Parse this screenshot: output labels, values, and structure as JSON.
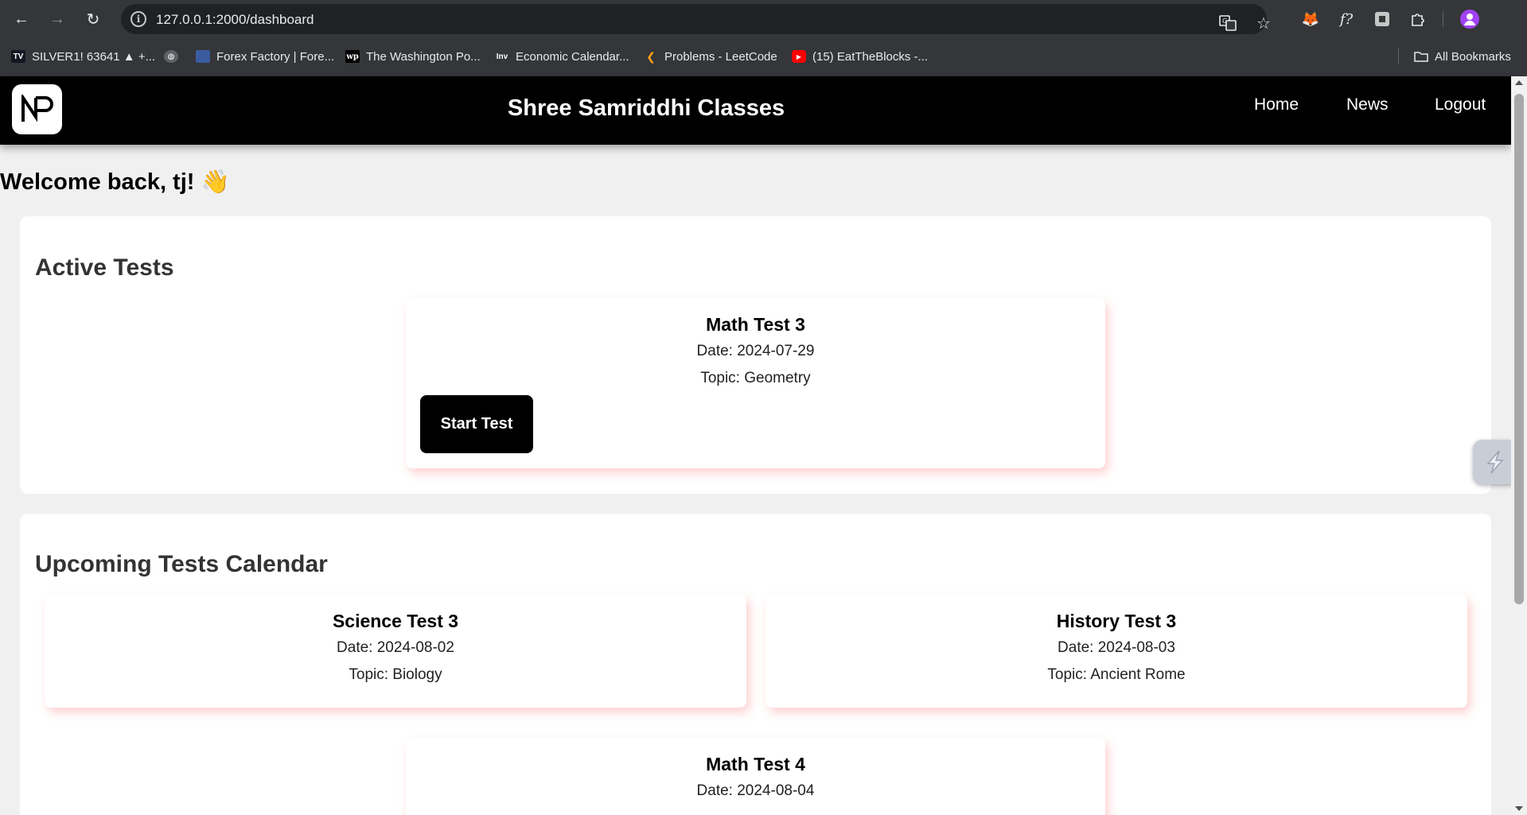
{
  "browser": {
    "url": "127.0.0.1:2000/dashboard",
    "bookmarks": [
      {
        "label": "SILVER1! 63641 ▲ +...",
        "icon": "tradingview-icon"
      },
      {
        "label": "",
        "icon": "globe-icon"
      },
      {
        "label": "Forex Factory | Fore...",
        "icon": "forex-factory-icon"
      },
      {
        "label": "The Washington Po...",
        "icon": "washington-post-icon"
      },
      {
        "label": "Economic Calendar...",
        "icon": "investing-icon"
      },
      {
        "label": "Problems - LeetCode",
        "icon": "leetcode-icon"
      },
      {
        "label": "(15) EatTheBlocks -...",
        "icon": "youtube-icon"
      }
    ],
    "all_bookmarks": "All Bookmarks"
  },
  "header": {
    "brand": "Shree Samriddhi Classes",
    "logo_text": "NP",
    "nav": {
      "home": "Home",
      "news": "News",
      "logout": "Logout"
    }
  },
  "welcome": "Welcome back, tj! 👋",
  "active_tests": {
    "title": "Active Tests",
    "tests": [
      {
        "name": "Math Test 3",
        "date": "Date: 2024-07-29",
        "topic": "Topic: Geometry",
        "button": "Start Test"
      }
    ]
  },
  "upcoming_tests": {
    "title": "Upcoming Tests Calendar",
    "tests": [
      {
        "name": "Science Test 3",
        "date": "Date: 2024-08-02",
        "topic": "Topic: Biology"
      },
      {
        "name": "History Test 3",
        "date": "Date: 2024-08-03",
        "topic": "Topic: Ancient Rome"
      },
      {
        "name": "Math Test 4",
        "date": "Date: 2024-08-04",
        "topic": ""
      }
    ]
  },
  "colors": {
    "header_bg": "#000000",
    "page_bg": "#f0f0f0",
    "card_shadow": "#ff7878",
    "button_bg": "#000000"
  }
}
